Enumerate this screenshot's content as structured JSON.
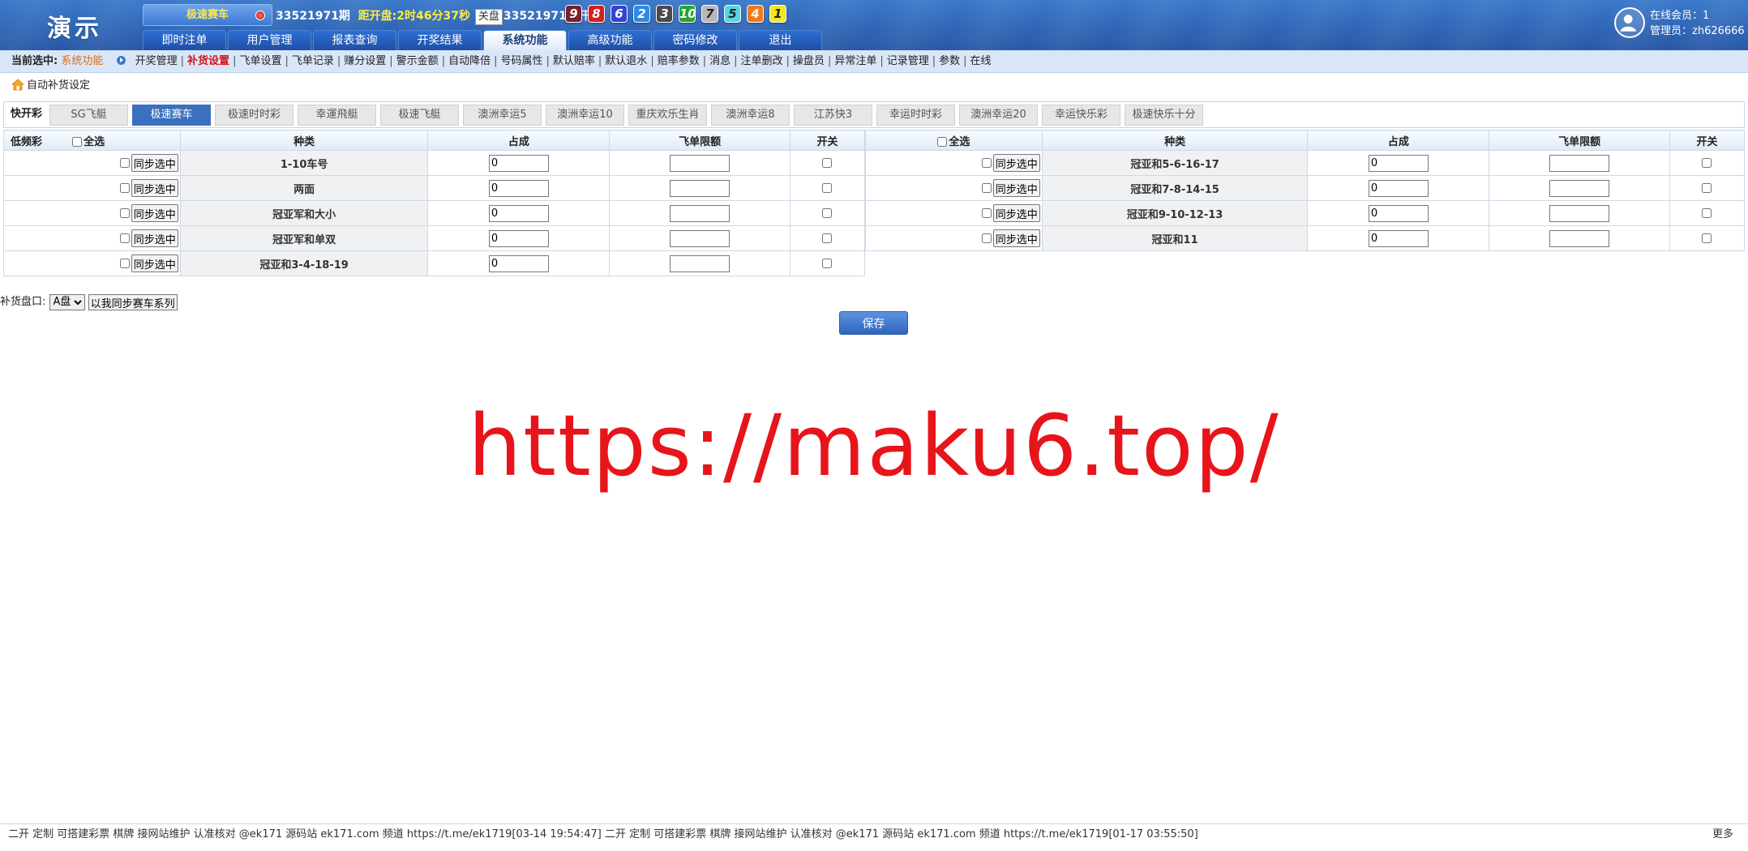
{
  "header": {
    "logo": "演示",
    "game_select": "极速赛车",
    "period_label": "33521971期",
    "countdown_label": "距开盘:",
    "countdown_value": "2时46分37秒",
    "closed_badge": "关盘",
    "last_period_label": "33521971期开奖:",
    "balls": [
      {
        "n": "9",
        "color": "#7a1f2d"
      },
      {
        "n": "8",
        "color": "#d61f1f"
      },
      {
        "n": "6",
        "color": "#3540d8"
      },
      {
        "n": "2",
        "color": "#2a8ae6"
      },
      {
        "n": "3",
        "color": "#4a4a4a"
      },
      {
        "n": "10",
        "color": "#22a832"
      },
      {
        "n": "7",
        "color": "#b8b8b8"
      },
      {
        "n": "5",
        "color": "#52d7e8"
      },
      {
        "n": "4",
        "color": "#f07a1a"
      },
      {
        "n": "1",
        "color": "#f2e81c"
      }
    ],
    "nav": [
      "即时注单",
      "用户管理",
      "报表查询",
      "开奖结果",
      "系统功能",
      "高级功能",
      "密码修改",
      "退出"
    ],
    "nav_active_index": 4,
    "online_label": "在线会员：1",
    "admin_label": "管理员：zh626666"
  },
  "subnav": {
    "current_label": "当前选中:",
    "current_value": "系统功能",
    "items": [
      "开奖管理",
      "补货设置",
      "飞单设置",
      "飞单记录",
      "赚分设置",
      "警示金额",
      "自动降倍",
      "号码属性",
      "默认赔率",
      "默认退水",
      "赔率参数",
      "消息",
      "注单删改",
      "操盘员",
      "异常注单",
      "记录管理",
      "参数",
      "在线"
    ],
    "active_index": 1
  },
  "page_title": "自动补货设定",
  "game_tabs": {
    "group_label": "快开彩",
    "tabs": [
      "SG飞艇",
      "极速赛车",
      "极速时时彩",
      "幸運飛艇",
      "极速飞艇",
      "澳洲幸运5",
      "澳洲幸运10",
      "重庆欢乐生肖",
      "澳洲幸运8",
      "江苏快3",
      "幸运时时彩",
      "澳洲幸运20",
      "幸运快乐彩",
      "极速快乐十分"
    ],
    "active_index": 1
  },
  "table": {
    "lowfreq_label": "低频彩",
    "select_all": "全选",
    "col_type": "种类",
    "col_share": "占成",
    "col_limit": "飞单限额",
    "col_switch": "开关",
    "sync_button": "同步选中",
    "left_rows": [
      {
        "type": "1-10车号",
        "share": "0",
        "limit": ""
      },
      {
        "type": "两面",
        "share": "0",
        "limit": ""
      },
      {
        "type": "冠亚军和大小",
        "share": "0",
        "limit": ""
      },
      {
        "type": "冠亚军和单双",
        "share": "0",
        "limit": ""
      },
      {
        "type": "冠亚和3-4-18-19",
        "share": "0",
        "limit": ""
      }
    ],
    "right_rows": [
      {
        "type": "冠亚和5-6-16-17",
        "share": "0",
        "limit": ""
      },
      {
        "type": "冠亚和7-8-14-15",
        "share": "0",
        "limit": ""
      },
      {
        "type": "冠亚和9-10-12-13",
        "share": "0",
        "limit": ""
      },
      {
        "type": "冠亚和11",
        "share": "0",
        "limit": ""
      }
    ]
  },
  "panel": {
    "label": "补货盘口:",
    "selected": "A盘",
    "sync_series_button": "以我同步赛车系列"
  },
  "save_button": "保存",
  "watermark": "https://maku6.top/",
  "footer": {
    "marquee": "二开 定制 可搭建彩票 棋牌 接网站维护 认准核对 @ek171 源码站 ek171.com 频道 https://t.me/ek1719[03-14 19:54:47] 二开 定制 可搭建彩票 棋牌 接网站维护 认准核对 @ek171 源码站 ek171.com 频道 https://t.me/ek1719[01-17 03:55:50]",
    "more": "更多"
  }
}
